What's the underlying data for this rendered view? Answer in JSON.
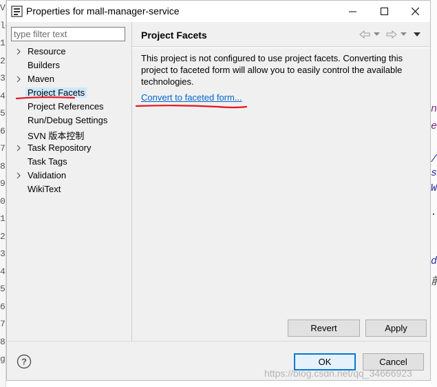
{
  "window": {
    "title": "Properties for mall-manager-service",
    "minimize_glyph": "—",
    "maximize_glyph": "☐",
    "close_glyph": "✕"
  },
  "background_editor": {
    "left_gutter": [
      "V",
      "lo",
      "1",
      "2",
      "3",
      "4",
      "5",
      "6",
      "7",
      "8",
      "9",
      "0",
      "1",
      "2",
      "3",
      "4",
      "5",
      "6",
      "7",
      "8",
      "g"
    ],
    "right_fragments": [
      "n",
      "e",
      "/",
      "s",
      "W",
      ".",
      "d",
      "前"
    ]
  },
  "sidebar": {
    "filter_placeholder": "type filter text",
    "items": [
      {
        "label": "Resource",
        "expandable": true
      },
      {
        "label": "Builders",
        "expandable": false
      },
      {
        "label": "Maven",
        "expandable": true
      },
      {
        "label": "Project Facets",
        "expandable": false,
        "selected": true
      },
      {
        "label": "Project References",
        "expandable": false
      },
      {
        "label": "Run/Debug Settings",
        "expandable": false
      },
      {
        "label": "SVN 版本控制",
        "expandable": false
      },
      {
        "label": "Task Repository",
        "expandable": true
      },
      {
        "label": "Task Tags",
        "expandable": false
      },
      {
        "label": "Validation",
        "expandable": true
      },
      {
        "label": "WikiText",
        "expandable": false
      }
    ]
  },
  "page": {
    "title": "Project Facets",
    "description": "This project is not configured to use project facets. Converting this project to faceted form will allow you to easily control the available technologies.",
    "convert_link": "Convert to faceted form...",
    "revert_label": "Revert",
    "apply_label": "Apply"
  },
  "footer": {
    "help_glyph": "?",
    "ok_label": "OK",
    "cancel_label": "Cancel"
  },
  "watermark": "https://blog.csdn.net/qq_34666923",
  "colors": {
    "link": "#0066cc",
    "selection": "#cce8ff",
    "annotation": "#e8141b",
    "default_button_border": "#0078d7"
  }
}
